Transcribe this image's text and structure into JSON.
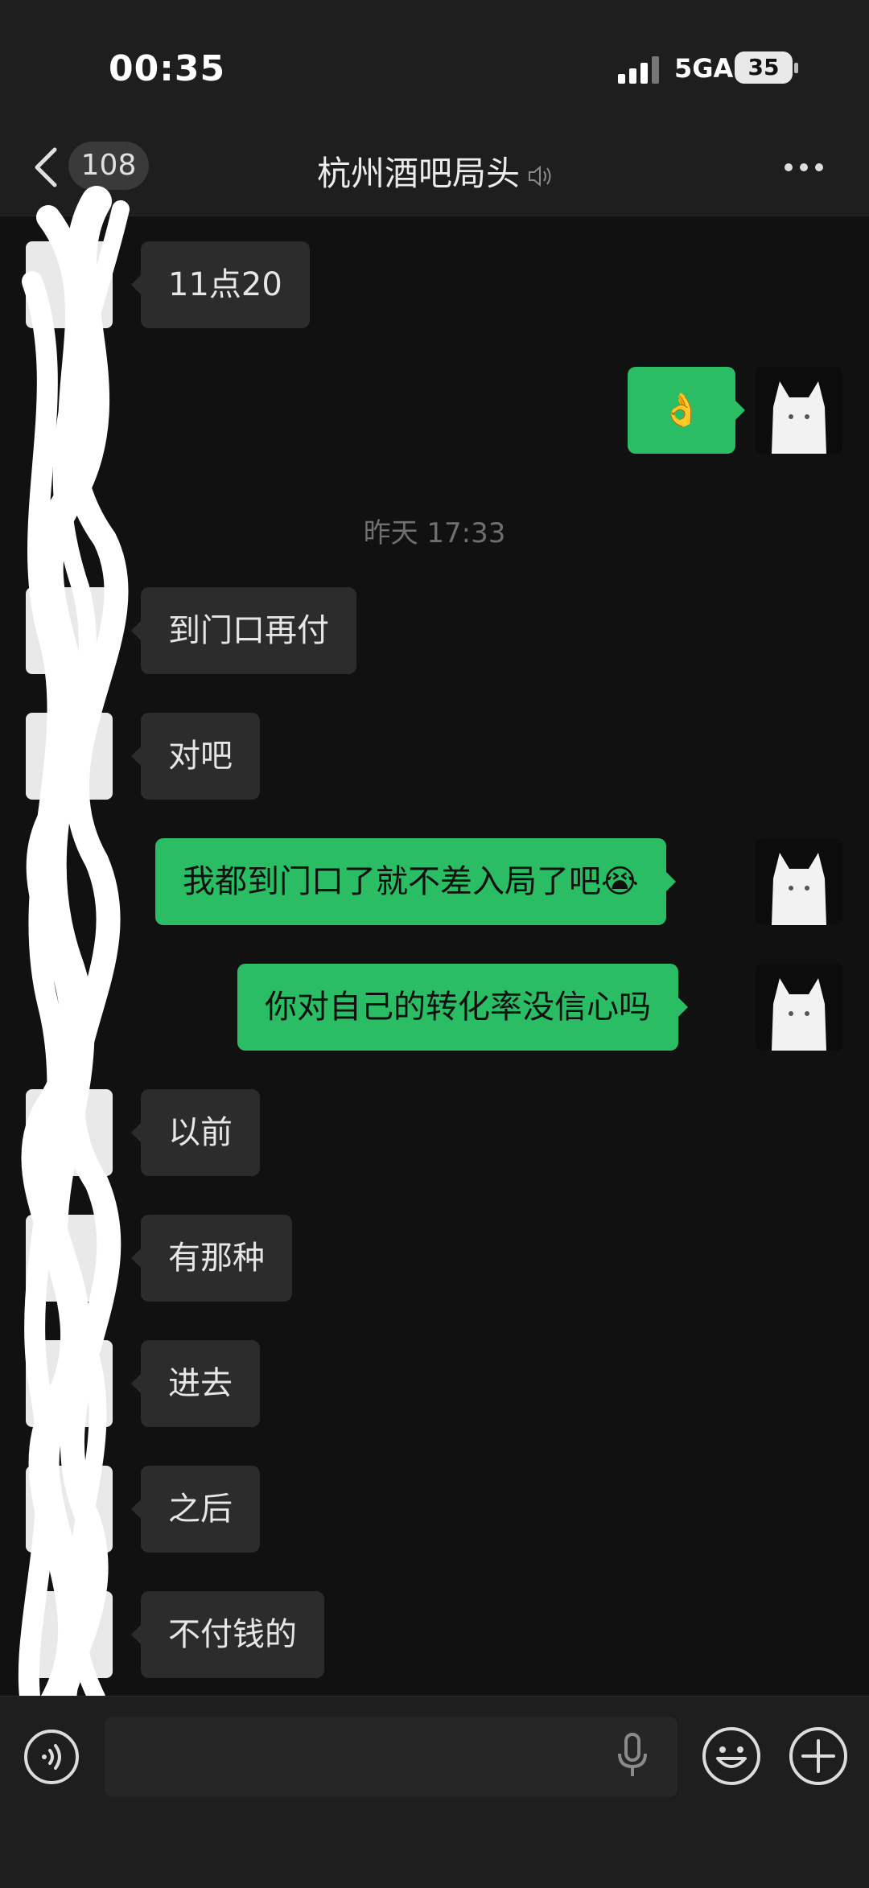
{
  "status_bar": {
    "time": "00:35",
    "network": "5GA",
    "battery": "35"
  },
  "header": {
    "unread_count": "108",
    "title": "杭州酒吧局头"
  },
  "timestamp": "昨天 17:33",
  "messages": [
    {
      "side": "left",
      "text": "11点20"
    },
    {
      "side": "right",
      "text": "👌"
    },
    {
      "side": "left",
      "text": "到门口再付"
    },
    {
      "side": "left",
      "text": "对吧"
    },
    {
      "side": "right",
      "text": "我都到门口了就不差入局了吧😭"
    },
    {
      "side": "right",
      "text": "你对自己的转化率没信心吗"
    },
    {
      "side": "left",
      "text": "以前"
    },
    {
      "side": "left",
      "text": "有那种"
    },
    {
      "side": "left",
      "text": "进去"
    },
    {
      "side": "left",
      "text": "之后"
    },
    {
      "side": "left",
      "text": "不付钱的"
    }
  ],
  "colors": {
    "outgoing_bubble": "#2bbd63",
    "incoming_bubble": "#2c2c2c",
    "background": "#111111"
  },
  "icons": [
    "back-chevron-icon",
    "sound-off-icon",
    "more-icon",
    "voice-toggle-icon",
    "microphone-icon",
    "emoji-icon",
    "plus-icon"
  ]
}
